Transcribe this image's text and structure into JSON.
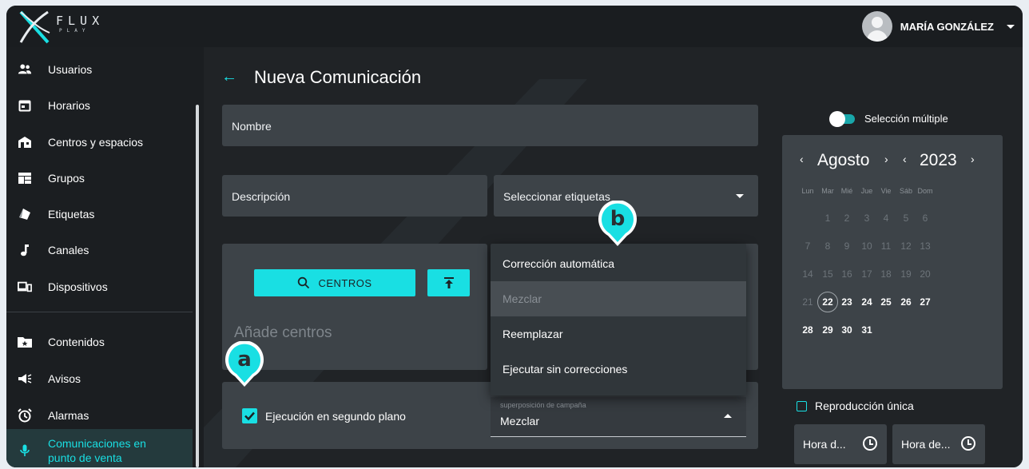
{
  "app": {
    "logo_text": "FLUX",
    "logo_sub": "PLAY"
  },
  "user": {
    "name": "MARÍA GONZÁLEZ"
  },
  "sidebar": {
    "items": [
      {
        "label": "Usuarios",
        "icon": "users-icon"
      },
      {
        "label": "Horarios",
        "icon": "calendar-icon"
      },
      {
        "label": "Centros y espacios",
        "icon": "store-icon"
      },
      {
        "label": "Grupos",
        "icon": "grid-icon"
      },
      {
        "label": "Etiquetas",
        "icon": "tag-icon"
      },
      {
        "label": "Canales",
        "icon": "music-note-icon"
      },
      {
        "label": "Dispositivos",
        "icon": "devices-icon"
      },
      {
        "label": "Contenidos",
        "icon": "folder-star-icon"
      },
      {
        "label": "Avisos",
        "icon": "megaphone-icon"
      },
      {
        "label": "Alarmas",
        "icon": "alarm-icon"
      },
      {
        "label": "Comunicaciones en punto de venta",
        "icon": "microphone-icon",
        "active": true
      }
    ]
  },
  "main": {
    "title": "Nueva Comunicación",
    "name_label": "Nombre",
    "description_label": "Descripción",
    "tags_label": "Seleccionar etiquetas",
    "centros_button": "CENTROS",
    "centros_placeholder": "Añade centros",
    "background_label": "Ejecución en segundo plano",
    "background_checked": true,
    "campaign_overlap": {
      "label": "superposición de campaña",
      "value": "Mezclar"
    },
    "dropdown_options": [
      {
        "label": "Corrección automática",
        "disabled": false
      },
      {
        "label": "Mezclar",
        "disabled": true
      },
      {
        "label": "Reemplazar",
        "disabled": false
      },
      {
        "label": "Ejecutar sin correcciones",
        "disabled": false
      }
    ],
    "callouts": [
      "a",
      "b"
    ]
  },
  "right": {
    "multi_select_label": "Selección múltiple",
    "calendar": {
      "month": "Agosto",
      "year": "2023",
      "weekdays": [
        "Lun",
        "Mar",
        "Mié",
        "Jue",
        "Vie",
        "Sáb",
        "Dom"
      ],
      "weeks": [
        [
          "",
          "1",
          "2",
          "3",
          "4",
          "5",
          "6"
        ],
        [
          "7",
          "8",
          "9",
          "10",
          "11",
          "12",
          "13"
        ],
        [
          "14",
          "15",
          "16",
          "17",
          "18",
          "19",
          "20"
        ],
        [
          "21",
          "22",
          "23",
          "24",
          "25",
          "26",
          "27"
        ],
        [
          "28",
          "29",
          "30",
          "31",
          "",
          "",
          ""
        ]
      ],
      "today": "22",
      "first_enabled": "22"
    },
    "single_play_label": "Reproducción única",
    "time_start_label": "Hora d...",
    "time_end_label": "Hora de..."
  },
  "colors": {
    "accent": "#19dfe3",
    "background": "#202326",
    "field": "#3d4348"
  }
}
